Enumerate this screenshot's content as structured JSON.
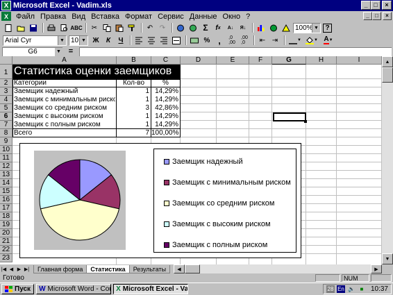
{
  "window": {
    "title": "Microsoft Excel - Vadim.xls"
  },
  "menu": [
    "Файл",
    "Правка",
    "Вид",
    "Вставка",
    "Формат",
    "Сервис",
    "Данные",
    "Окно",
    "?"
  ],
  "toolbar": {
    "font": "Arial Cyr",
    "size": "10",
    "zoom": "100%"
  },
  "formula": {
    "namebox": "G6",
    "eq": "="
  },
  "columns": [
    "A",
    "B",
    "C",
    "D",
    "E",
    "F",
    "G",
    "H",
    "I"
  ],
  "rows": [
    "1",
    "2",
    "3",
    "4",
    "5",
    "6",
    "7",
    "8",
    "9",
    "10",
    "11",
    "12",
    "13",
    "14",
    "15",
    "16",
    "17",
    "18",
    "19",
    "20",
    "21",
    "22",
    "23"
  ],
  "table": {
    "title": "Статистика оценки заемщиков",
    "headers": [
      "Категории",
      "Кол-во",
      "%"
    ],
    "rows": [
      {
        "cat": "Заемщик надежный",
        "count": "1",
        "pct": "14,29%"
      },
      {
        "cat": "Заемщик с минимальным риском",
        "count": "1",
        "pct": "14,29%"
      },
      {
        "cat": "Заемщик со средним риском",
        "count": "3",
        "pct": "42,86%"
      },
      {
        "cat": "Заемщик с высоким риском",
        "count": "1",
        "pct": "14,29%"
      },
      {
        "cat": "Заемщик с полным риском",
        "count": "1",
        "pct": "14,29%"
      }
    ],
    "total": {
      "label": "Всего",
      "count": "7",
      "pct": "100,00%"
    }
  },
  "chart_data": {
    "type": "pie",
    "categories": [
      "Заемщик надежный",
      "Заемщик с минимальным риском",
      "Заемщик со средним риском",
      "Заемщик с высоким риском",
      "Заемщик с полным риском"
    ],
    "values": [
      1,
      1,
      3,
      1,
      1
    ],
    "colors": [
      "#9999ff",
      "#993366",
      "#ffffcc",
      "#ccffff",
      "#660066"
    ],
    "legend": "right"
  },
  "tabs": [
    "Главная форма",
    "Статистика",
    "Результаты"
  ],
  "status": {
    "ready": "Готово",
    "num": "NUM"
  },
  "taskbar": {
    "start": "Пуск",
    "items": [
      "Microsoft Word - Course p...",
      "Microsoft Excel - Vad..."
    ],
    "lang": "En",
    "clock": "10:37"
  }
}
